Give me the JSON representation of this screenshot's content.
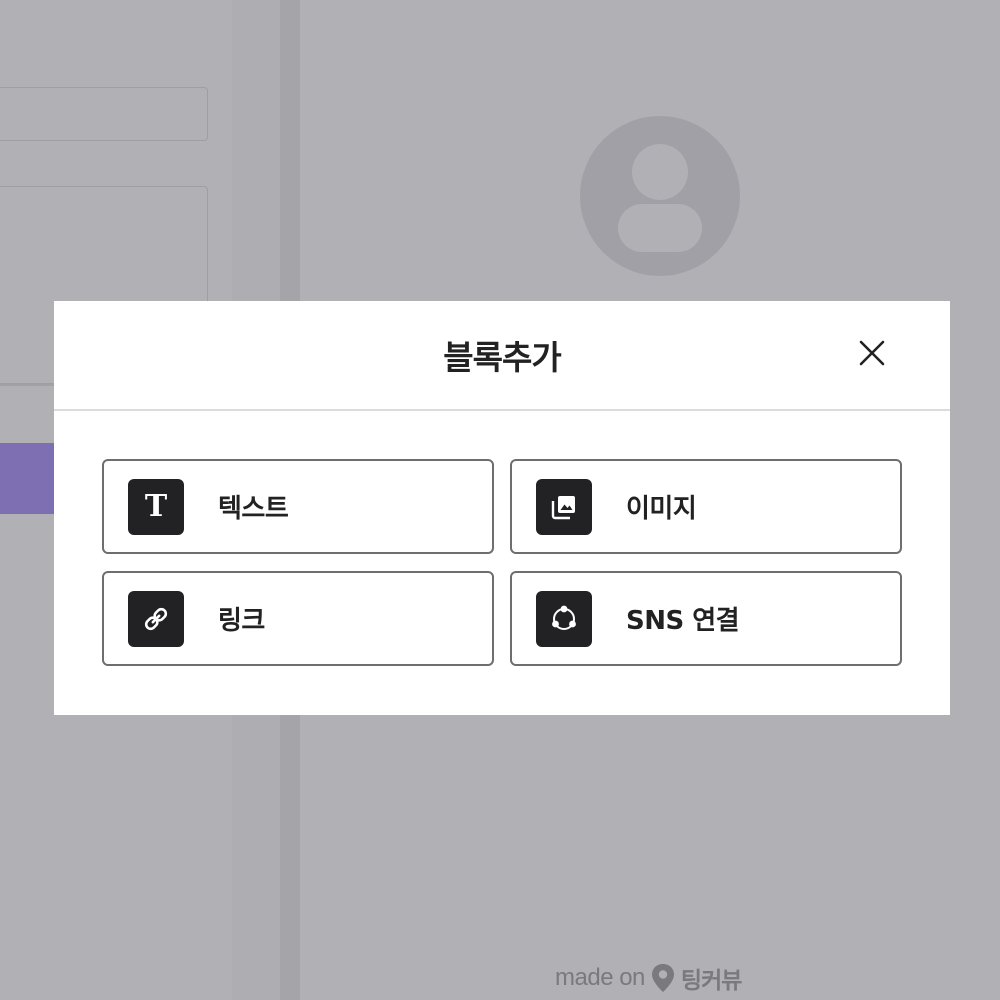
{
  "modal": {
    "title": "블록추가",
    "close_icon": "close-icon",
    "options": [
      {
        "label": "텍스트",
        "icon": "text-icon"
      },
      {
        "label": "이미지",
        "icon": "image-icon"
      },
      {
        "label": "링크",
        "icon": "link-icon"
      },
      {
        "label": "SNS 연결",
        "icon": "share-icon"
      }
    ]
  },
  "footer": {
    "made_on": "made on",
    "brand": "팅커뷰",
    "brand_icon": "location-pin-icon"
  },
  "colors": {
    "overlay_background": "#b1b0b5",
    "accent_purple": "#7e6fb3",
    "icon_tile": "#222225",
    "card_border": "#6e6e6e",
    "text_dark": "#222222"
  }
}
